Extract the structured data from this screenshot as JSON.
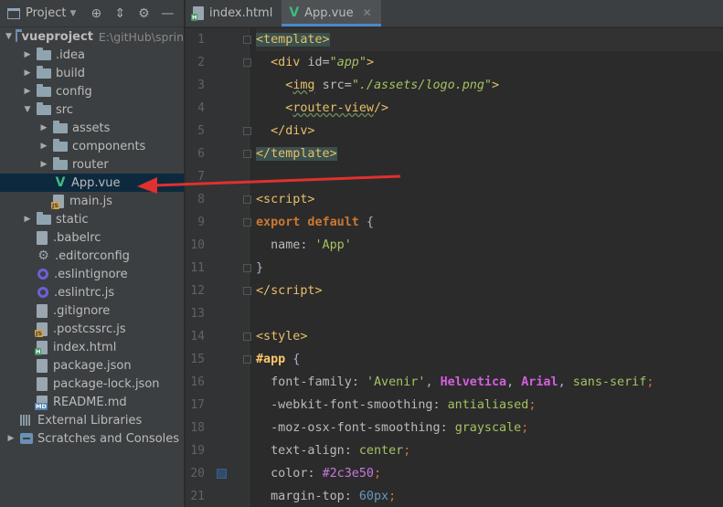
{
  "project_panel": {
    "title": "Project",
    "tree": [
      {
        "label": "vueproject",
        "hint": "E:\\gitHub\\sprin",
        "type": "root",
        "depth": 0,
        "expanded": true
      },
      {
        "label": ".idea",
        "type": "folder",
        "depth": 1,
        "expanded": false
      },
      {
        "label": "build",
        "type": "folder",
        "depth": 1,
        "expanded": false
      },
      {
        "label": "config",
        "type": "folder",
        "depth": 1,
        "expanded": false
      },
      {
        "label": "src",
        "type": "folder",
        "depth": 1,
        "expanded": true
      },
      {
        "label": "assets",
        "type": "folder",
        "depth": 2,
        "expanded": false
      },
      {
        "label": "components",
        "type": "folder",
        "depth": 2,
        "expanded": false
      },
      {
        "label": "router",
        "type": "folder",
        "depth": 2,
        "expanded": false
      },
      {
        "label": "App.vue",
        "type": "vue",
        "depth": 2,
        "selected": true
      },
      {
        "label": "main.js",
        "type": "js",
        "depth": 2
      },
      {
        "label": "static",
        "type": "folder",
        "depth": 1,
        "expanded": false
      },
      {
        "label": ".babelrc",
        "type": "file",
        "depth": 1
      },
      {
        "label": ".editorconfig",
        "type": "gear",
        "depth": 1
      },
      {
        "label": ".eslintignore",
        "type": "eslint",
        "depth": 1
      },
      {
        "label": ".eslintrc.js",
        "type": "eslint",
        "depth": 1
      },
      {
        "label": ".gitignore",
        "type": "file",
        "depth": 1
      },
      {
        "label": ".postcssrc.js",
        "type": "js",
        "depth": 1
      },
      {
        "label": "index.html",
        "type": "html",
        "depth": 1
      },
      {
        "label": "package.json",
        "type": "file",
        "depth": 1
      },
      {
        "label": "package-lock.json",
        "type": "file",
        "depth": 1
      },
      {
        "label": "README.md",
        "type": "md",
        "depth": 1
      },
      {
        "label": "External Libraries",
        "type": "extlib",
        "depth": 0
      },
      {
        "label": "Scratches and Consoles",
        "type": "scratch",
        "depth": 0,
        "expanded": false
      }
    ]
  },
  "editor": {
    "tabs": [
      {
        "label": "index.html",
        "active": false
      },
      {
        "label": "App.vue",
        "active": true
      }
    ],
    "line_numbers": [
      "1",
      "2",
      "3",
      "4",
      "5",
      "6",
      "7",
      "8",
      "9",
      "10",
      "11",
      "12",
      "13",
      "14",
      "15",
      "16",
      "17",
      "18",
      "19",
      "20",
      "21"
    ],
    "code": {
      "l2_attr_val": "\"app\"",
      "l3_src": "\"./assets/logo.png\"",
      "l10_name": "'App'",
      "l16_fonts": [
        "'Avenir'",
        "Helvetica",
        "Arial",
        "sans-serif"
      ],
      "l17_value": "antialiased",
      "l18_value": "grayscale",
      "l19_value": "center",
      "l20_value": "#2c3e50",
      "l21_value": "60px"
    }
  },
  "colors": {
    "selection": "#0d293e",
    "annotation_arrow": "#e03030",
    "active_tab_underline": "#4a88c7"
  }
}
